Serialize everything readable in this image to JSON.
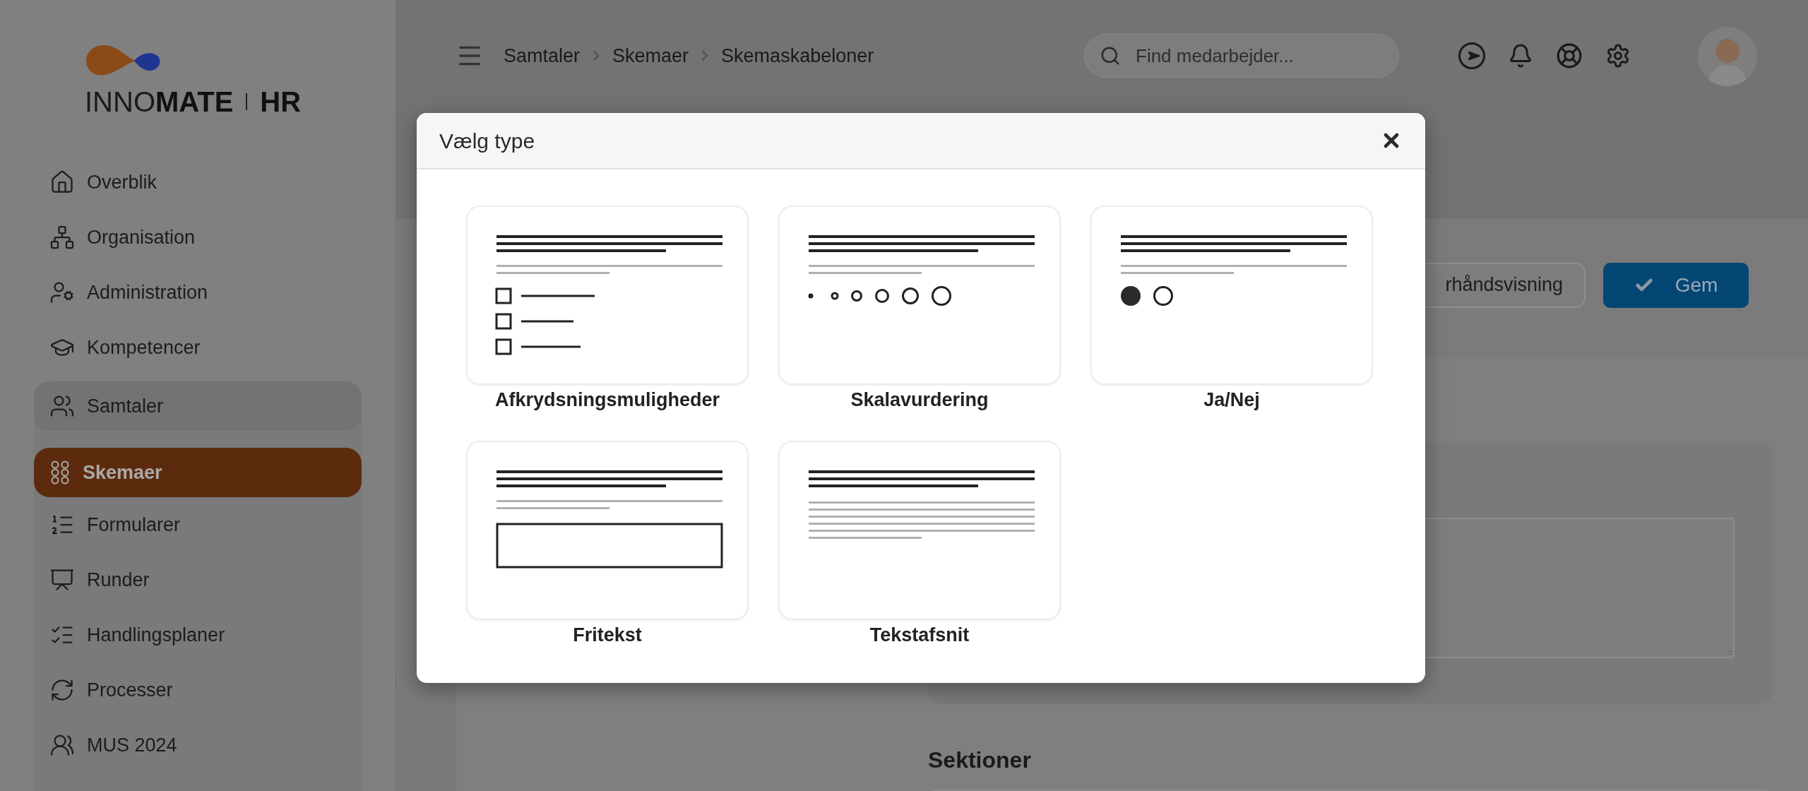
{
  "logo": {
    "light": "INNO",
    "bold": "MATE",
    "product": "HR"
  },
  "nav": [
    {
      "label": "Overblik",
      "selected": false
    },
    {
      "label": "Organisation",
      "selected": false
    },
    {
      "label": "Administration",
      "selected": false
    },
    {
      "label": "Kompetencer",
      "selected": false
    },
    {
      "label": "Samtaler",
      "selected": false,
      "children": [
        {
          "label": "Skemaer",
          "selected": true
        },
        {
          "label": "Formularer",
          "selected": false
        },
        {
          "label": "Runder",
          "selected": false
        },
        {
          "label": "Handlingsplaner",
          "selected": false
        },
        {
          "label": "Processer",
          "selected": false
        },
        {
          "label": "MUS 2024",
          "selected": false
        }
      ]
    }
  ],
  "breadcrumbs": [
    "Samtaler",
    "Skemaer",
    "Skemaskabeloner"
  ],
  "search": {
    "placeholder": "Find medarbejder..."
  },
  "toolbar": {
    "preview_button": "rhåndsvisning",
    "save_button": "Gem"
  },
  "section_heading": "Sektioner",
  "modal": {
    "title": "Vælg type",
    "types": [
      {
        "label": "Afkrydsningsmuligheder",
        "kind": "checkbox"
      },
      {
        "label": "Skalavurdering",
        "kind": "scale"
      },
      {
        "label": "Ja/Nej",
        "kind": "yesno"
      },
      {
        "label": "Fritekst",
        "kind": "freetext"
      },
      {
        "label": "Tekstafsnit",
        "kind": "textblock"
      }
    ]
  }
}
